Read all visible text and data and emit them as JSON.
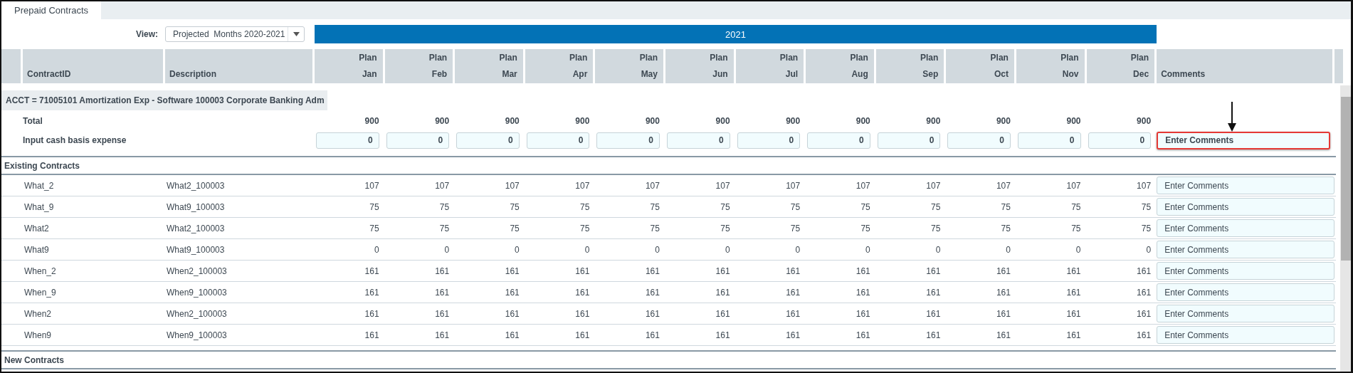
{
  "tabs": [
    {
      "label": "Prepaid Contracts",
      "selected": true
    }
  ],
  "view": {
    "label": "View:",
    "value": "Projected  Months 2020-2021"
  },
  "year_banner": "2021",
  "columns": {
    "contract_id": "ContractID",
    "description": "Description",
    "comments": "Comments",
    "months": [
      {
        "plan": "Plan",
        "month": "Jan"
      },
      {
        "plan": "Plan",
        "month": "Feb"
      },
      {
        "plan": "Plan",
        "month": "Mar"
      },
      {
        "plan": "Plan",
        "month": "Apr"
      },
      {
        "plan": "Plan",
        "month": "May"
      },
      {
        "plan": "Plan",
        "month": "Jun"
      },
      {
        "plan": "Plan",
        "month": "Jul"
      },
      {
        "plan": "Plan",
        "month": "Aug"
      },
      {
        "plan": "Plan",
        "month": "Sep"
      },
      {
        "plan": "Plan",
        "month": "Oct"
      },
      {
        "plan": "Plan",
        "month": "Nov"
      },
      {
        "plan": "Plan",
        "month": "Dec"
      }
    ]
  },
  "group": {
    "label": "ACCT = 71005101 Amortization Exp - Software 100003 Corporate Banking Adm"
  },
  "total": {
    "label": "Total",
    "values": [
      "900",
      "900",
      "900",
      "900",
      "900",
      "900",
      "900",
      "900",
      "900",
      "900",
      "900",
      "900"
    ]
  },
  "input_row": {
    "label": "Input cash basis expense",
    "values": [
      "0",
      "0",
      "0",
      "0",
      "0",
      "0",
      "0",
      "0",
      "0",
      "0",
      "0",
      "0"
    ],
    "comment": {
      "placeholder": "Enter Comments",
      "highlighted": true
    }
  },
  "sections": [
    {
      "title": "Existing Contracts",
      "rows": [
        {
          "contract_id": "What_2",
          "description": "What2_100003",
          "values": [
            "107",
            "107",
            "107",
            "107",
            "107",
            "107",
            "107",
            "107",
            "107",
            "107",
            "107",
            "107"
          ],
          "comment_placeholder": "Enter Comments"
        },
        {
          "contract_id": "What_9",
          "description": "What9_100003",
          "values": [
            "75",
            "75",
            "75",
            "75",
            "75",
            "75",
            "75",
            "75",
            "75",
            "75",
            "75",
            "75"
          ],
          "comment_placeholder": "Enter Comments"
        },
        {
          "contract_id": "What2",
          "description": "What2_100003",
          "values": [
            "75",
            "75",
            "75",
            "75",
            "75",
            "75",
            "75",
            "75",
            "75",
            "75",
            "75",
            "75"
          ],
          "comment_placeholder": "Enter Comments"
        },
        {
          "contract_id": "What9",
          "description": "What9_100003",
          "values": [
            "0",
            "0",
            "0",
            "0",
            "0",
            "0",
            "0",
            "0",
            "0",
            "0",
            "0",
            "0"
          ],
          "comment_placeholder": "Enter Comments"
        },
        {
          "contract_id": "When_2",
          "description": "When2_100003",
          "values": [
            "161",
            "161",
            "161",
            "161",
            "161",
            "161",
            "161",
            "161",
            "161",
            "161",
            "161",
            "161"
          ],
          "comment_placeholder": "Enter Comments"
        },
        {
          "contract_id": "When_9",
          "description": "When9_100003",
          "values": [
            "161",
            "161",
            "161",
            "161",
            "161",
            "161",
            "161",
            "161",
            "161",
            "161",
            "161",
            "161"
          ],
          "comment_placeholder": "Enter Comments"
        },
        {
          "contract_id": "When2",
          "description": "When2_100003",
          "values": [
            "161",
            "161",
            "161",
            "161",
            "161",
            "161",
            "161",
            "161",
            "161",
            "161",
            "161",
            "161"
          ],
          "comment_placeholder": "Enter Comments"
        },
        {
          "contract_id": "When9",
          "description": "When9_100003",
          "values": [
            "161",
            "161",
            "161",
            "161",
            "161",
            "161",
            "161",
            "161",
            "161",
            "161",
            "161",
            "161"
          ],
          "comment_placeholder": "Enter Comments"
        }
      ]
    },
    {
      "title": "New Contracts"
    }
  ]
}
